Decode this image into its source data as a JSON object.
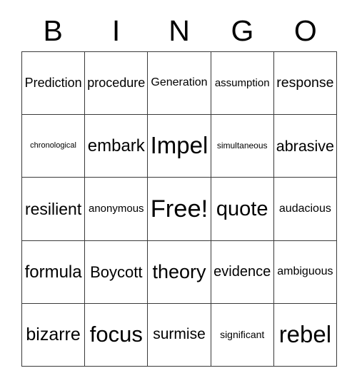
{
  "card": {
    "title": "BINGO",
    "header_letters": [
      "B",
      "I",
      "N",
      "G",
      "O"
    ],
    "columns": 5,
    "rows": 5,
    "colors": {
      "background": "#ffffff",
      "border": "#3a3a3a",
      "text": "#000000"
    },
    "cells": [
      {
        "text": "Prediction",
        "font_size": "18px",
        "free": false
      },
      {
        "text": "procedure",
        "font_size": "19px",
        "free": false
      },
      {
        "text": "Generation",
        "font_size": "17px",
        "free": false
      },
      {
        "text": "assumption",
        "font_size": "15px",
        "free": false
      },
      {
        "text": "response",
        "font_size": "21px",
        "free": false
      },
      {
        "text": "chronological",
        "font_size": "11px",
        "free": false
      },
      {
        "text": "embark",
        "font_size": "25px",
        "free": false
      },
      {
        "text": "Impel",
        "font_size": "33px",
        "free": false
      },
      {
        "text": "simultaneous",
        "font_size": "12px",
        "free": false
      },
      {
        "text": "abrasive",
        "font_size": "23px",
        "free": false
      },
      {
        "text": "resilient",
        "font_size": "23px",
        "free": false
      },
      {
        "text": "anonymous",
        "font_size": "15px",
        "free": false
      },
      {
        "text": "Free!",
        "font_size": "36px",
        "free": true
      },
      {
        "text": "quote",
        "font_size": "29px",
        "free": false
      },
      {
        "text": "audacious",
        "font_size": "16px",
        "free": false
      },
      {
        "text": "formula",
        "font_size": "24px",
        "free": false
      },
      {
        "text": "Boycott",
        "font_size": "22px",
        "free": false
      },
      {
        "text": "theory",
        "font_size": "27px",
        "free": false
      },
      {
        "text": "evidence",
        "font_size": "20px",
        "free": false
      },
      {
        "text": "ambiguous",
        "font_size": "16px",
        "free": false
      },
      {
        "text": "bizarre",
        "font_size": "25px",
        "free": false
      },
      {
        "text": "focus",
        "font_size": "31px",
        "free": false
      },
      {
        "text": "surmise",
        "font_size": "21px",
        "free": false
      },
      {
        "text": "significant",
        "font_size": "14px",
        "free": false
      },
      {
        "text": "rebel",
        "font_size": "33px",
        "free": false
      }
    ]
  }
}
